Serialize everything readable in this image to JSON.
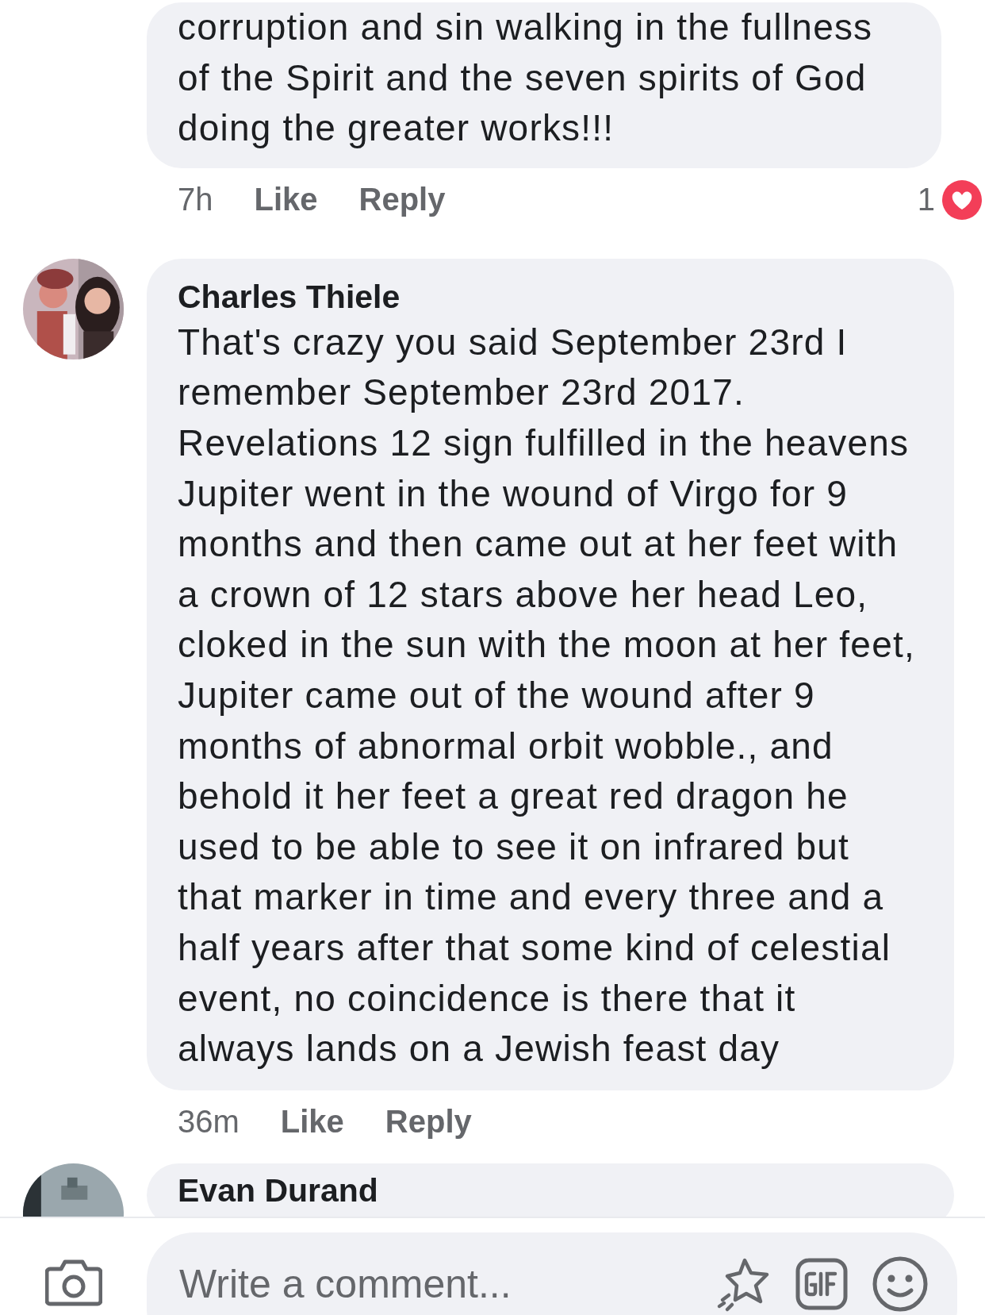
{
  "comments": [
    {
      "lines": [
        "corruption and sin walking in the fullness",
        "of the Spirit and the seven spirits of God",
        "doing the greater works!!!"
      ],
      "time": "7h",
      "like": "Like",
      "reply": "Reply",
      "reaction_count": "1"
    },
    {
      "author": "Charles Thiele",
      "lines": [
        "That's crazy you said September 23rd I",
        "remember September 23rd 2017.",
        "Revelations 12 sign fulfilled in the heavens",
        "Jupiter went in the wound of Virgo for 9",
        "months and then came out at her feet with",
        "a crown of 12 stars above her head Leo,",
        "cloked in the sun with the moon at her feet,",
        "Jupiter came out of the wound after 9",
        "months of abnormal orbit wobble., and",
        "behold it her feet a great red dragon he",
        "used to be able to see it on infrared but",
        "that marker in time and every three and a",
        "half years after that some kind of celestial",
        "event, no coincidence is there that it",
        "always lands on a Jewish feast day"
      ],
      "time": "36m",
      "like": "Like",
      "reply": "Reply"
    },
    {
      "author": "Evan Durand"
    }
  ],
  "composer": {
    "placeholder": "Write a comment..."
  }
}
